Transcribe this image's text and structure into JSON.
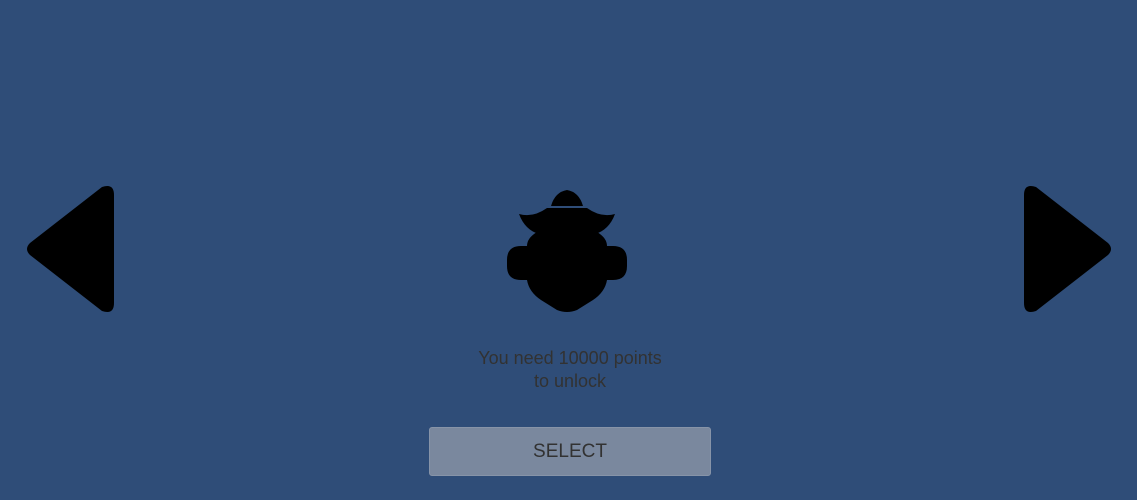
{
  "colors": {
    "background": "#2f4d78",
    "arrow": "#000000",
    "silhouette": "#000000",
    "text": "#323232",
    "button": "#7a889e"
  },
  "navigation": {
    "previous_icon": "triangle-left-icon",
    "next_icon": "triangle-right-icon"
  },
  "character": {
    "icon": "locked-character-silhouette-icon",
    "locked": true
  },
  "unlock_message": {
    "line1": "You need 10000 points",
    "line2": "to unlock"
  },
  "select_button": {
    "label": "SELECT"
  }
}
